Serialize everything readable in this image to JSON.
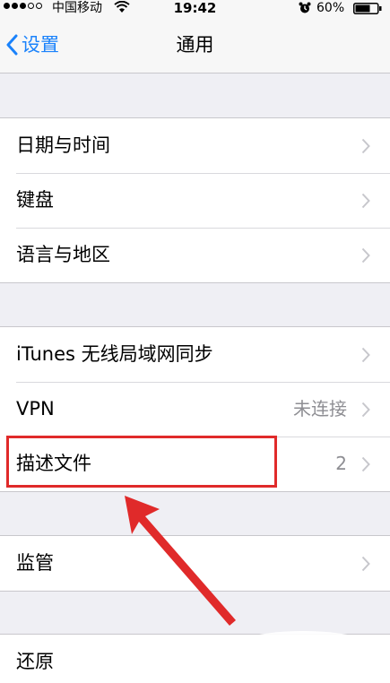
{
  "status_bar": {
    "carrier": "中国移动",
    "time": "19:42",
    "battery": "60%",
    "icons": [
      "signal-dots-icon",
      "wifi-icon",
      "alarm-icon",
      "battery-icon"
    ]
  },
  "nav": {
    "back_label": "设置",
    "title": "通用",
    "accent_color": "#1a82fb"
  },
  "groups": [
    {
      "rows": [
        {
          "label": "日期与时间",
          "value": ""
        },
        {
          "label": "键盘",
          "value": ""
        },
        {
          "label": "语言与地区",
          "value": ""
        }
      ]
    },
    {
      "rows": [
        {
          "label": "iTunes 无线局域网同步",
          "value": ""
        },
        {
          "label": "VPN",
          "value": "未连接"
        },
        {
          "label": "描述文件",
          "value": "2"
        }
      ]
    },
    {
      "rows": [
        {
          "label": "监管",
          "value": ""
        }
      ]
    },
    {
      "rows": [
        {
          "label": "还原",
          "value": ""
        }
      ]
    }
  ],
  "annotation": {
    "highlighted_row": "描述文件",
    "color": "#e02a2a"
  },
  "colors": {
    "background": "#efeff4",
    "separator": "#c8c7cc",
    "secondary_text": "#8e8e93",
    "chevron": "#c7c7cc"
  }
}
